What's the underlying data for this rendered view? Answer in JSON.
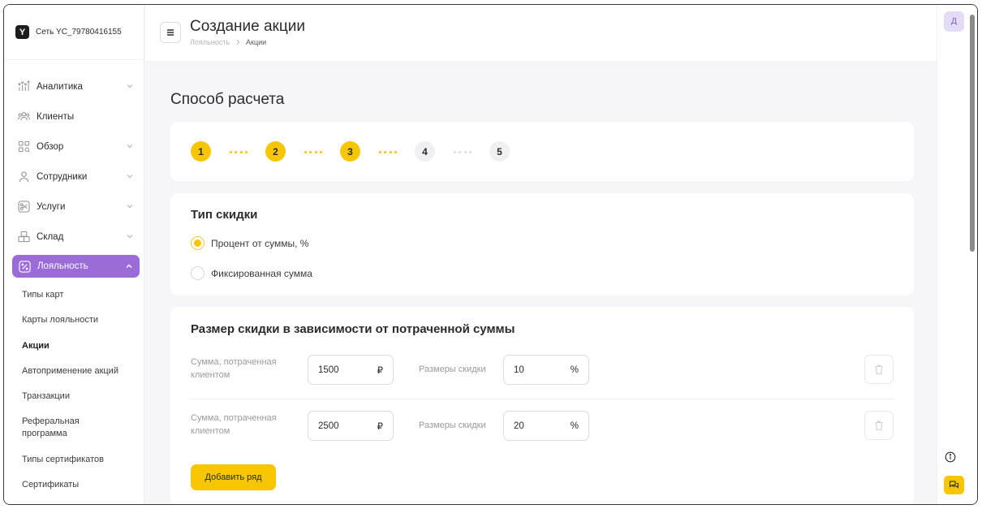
{
  "brand": {
    "name": "Сеть YC_79780416155",
    "logo_glyph": "Y"
  },
  "sidebar": {
    "items": [
      {
        "label": "Аналитика",
        "icon": "analytics-icon",
        "has_chevron": true
      },
      {
        "label": "Клиенты",
        "icon": "clients-icon",
        "has_chevron": false
      },
      {
        "label": "Обзор",
        "icon": "overview-icon",
        "has_chevron": true
      },
      {
        "label": "Сотрудники",
        "icon": "user-icon",
        "has_chevron": true
      },
      {
        "label": "Услуги",
        "icon": "scissors-icon",
        "has_chevron": true
      },
      {
        "label": "Склад",
        "icon": "boxes-icon",
        "has_chevron": true
      },
      {
        "label": "Лояльность",
        "icon": "percent-icon",
        "has_chevron": true,
        "active": true
      }
    ],
    "subitems": [
      {
        "label": "Типы карт"
      },
      {
        "label": "Карты лояльности"
      },
      {
        "label": "Акции",
        "current": true
      },
      {
        "label": "Автоприменение акций"
      },
      {
        "label": "Транзакции"
      },
      {
        "label": "Реферальная программа"
      },
      {
        "label": "Типы сертификатов"
      },
      {
        "label": "Сертификаты"
      }
    ]
  },
  "header": {
    "title": "Создание акции",
    "breadcrumb": [
      "Лояльность",
      "Акции"
    ]
  },
  "user": {
    "avatar_initial": "Д"
  },
  "main": {
    "section_title": "Способ расчета",
    "steps": [
      {
        "label": "1",
        "state": "done"
      },
      {
        "label": "2",
        "state": "done"
      },
      {
        "label": "3",
        "state": "done"
      },
      {
        "label": "4",
        "state": "todo"
      },
      {
        "label": "5",
        "state": "todo"
      }
    ],
    "discount_type": {
      "title": "Тип скидки",
      "options": [
        {
          "label": "Процент от суммы, %",
          "selected": true
        },
        {
          "label": "Фиксированная сумма",
          "selected": false
        }
      ]
    },
    "discount_size": {
      "title": "Размер скидки в зависимости от потраченной суммы",
      "rows": [
        {
          "spent_label": "Сумма, потраченная клиентом",
          "spent_value": "1500",
          "currency": "₽",
          "size_label": "Размеры скидки",
          "size_value": "10",
          "unit": "%"
        },
        {
          "spent_label": "Сумма, потраченная клиентом",
          "spent_value": "2500",
          "currency": "₽",
          "size_label": "Размеры скидки",
          "size_value": "20",
          "unit": "%"
        }
      ],
      "add_button": "Добавить ряд"
    }
  },
  "colors": {
    "accent": "#f7c600",
    "active_nav": "#9b6bd8"
  }
}
